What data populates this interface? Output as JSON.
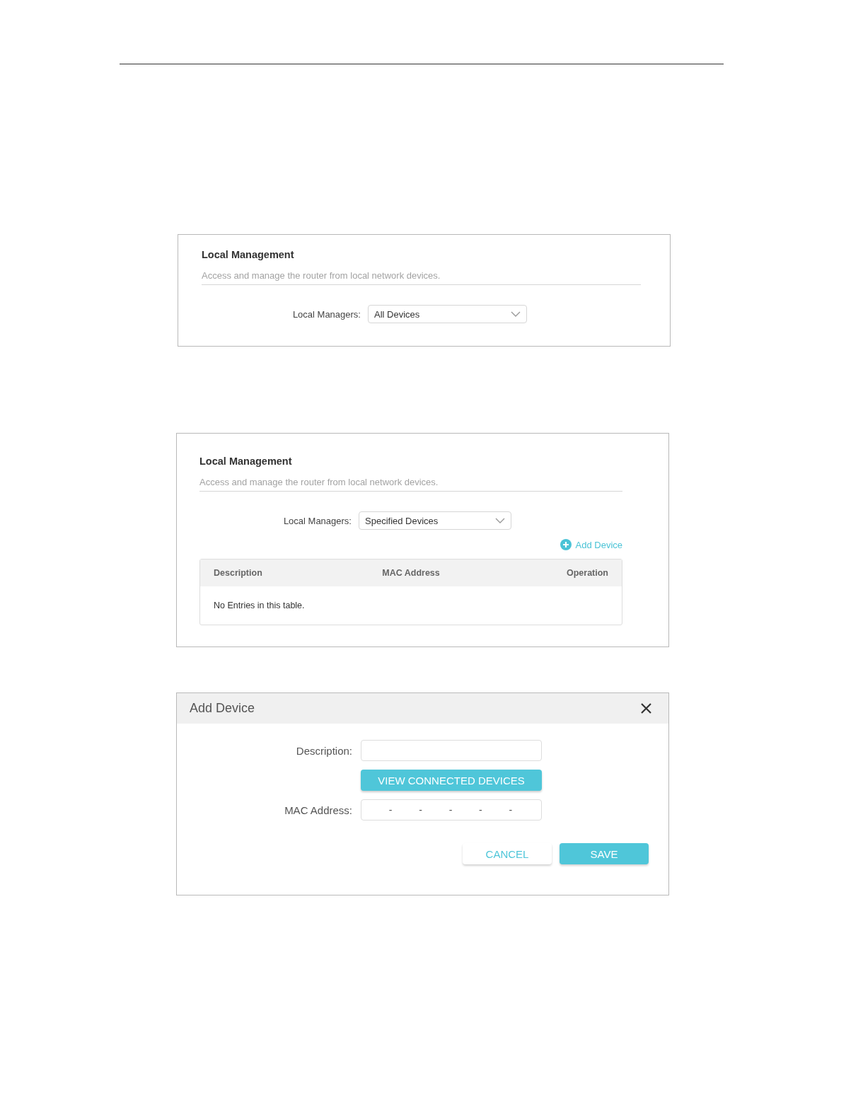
{
  "panels": [
    {
      "title": "Local Management",
      "description": "Access and manage the router from local network devices.",
      "managers_label": "Local Managers:",
      "managers_value": "All Devices"
    },
    {
      "title": "Local Management",
      "description": "Access and manage the router from local network devices.",
      "managers_label": "Local Managers:",
      "managers_value": "Specified Devices",
      "add_device": "Add Device",
      "table": {
        "columns": [
          "Description",
          "MAC Address",
          "Operation"
        ],
        "empty_message": "No Entries in this table."
      }
    }
  ],
  "dialog": {
    "title": "Add Device",
    "rows": [
      {
        "kind": "text",
        "label": "Description:"
      },
      {
        "kind": "button",
        "label": "VIEW CONNECTED DEVICES"
      },
      {
        "kind": "mac",
        "label": "MAC Address:",
        "separators": [
          "-",
          "-",
          "-",
          "-",
          "-"
        ]
      }
    ],
    "buttons": [
      {
        "kind": "secondary",
        "label": "CANCEL"
      },
      {
        "kind": "primary",
        "label": "SAVE"
      }
    ]
  }
}
